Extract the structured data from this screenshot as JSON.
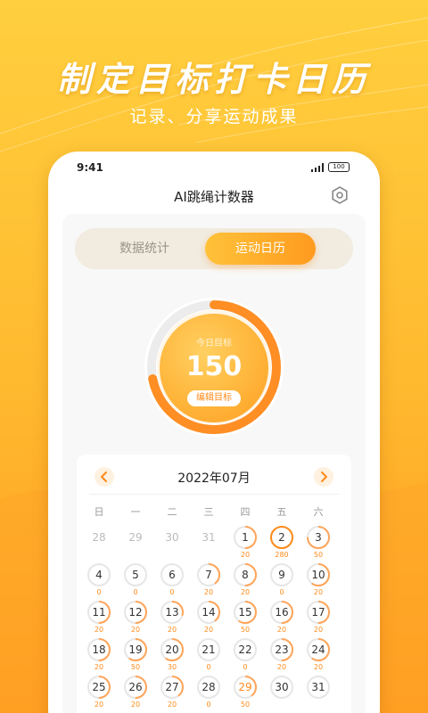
{
  "promo": {
    "title": "制定目标打卡日历",
    "subtitle": "记录、分享运动成果"
  },
  "status_bar": {
    "time": "9:41",
    "battery": "100"
  },
  "nav": {
    "title": "AI跳绳计数器"
  },
  "tabs": [
    {
      "label": "数据统计",
      "active": false
    },
    {
      "label": "运动日历",
      "active": true
    }
  ],
  "goal": {
    "label": "今日目标",
    "value": "150",
    "edit_label": "编辑目标",
    "progress": 0.72
  },
  "calendar": {
    "month": "2022年07月",
    "weekdays": [
      "日",
      "一",
      "二",
      "三",
      "四",
      "五",
      "六"
    ],
    "weeks": [
      [
        {
          "day": "28",
          "count": "",
          "muted": true,
          "progress": 0
        },
        {
          "day": "29",
          "count": "",
          "muted": true,
          "progress": 0
        },
        {
          "day": "30",
          "count": "",
          "muted": true,
          "progress": 0
        },
        {
          "day": "31",
          "count": "",
          "muted": true,
          "progress": 0
        },
        {
          "day": "1",
          "count": "20",
          "progress": 0.5
        },
        {
          "day": "2",
          "count": "280",
          "progress": 1
        },
        {
          "day": "3",
          "count": "50",
          "progress": 0.75
        }
      ],
      [
        {
          "day": "4",
          "count": "0",
          "progress": 0
        },
        {
          "day": "5",
          "count": "0",
          "progress": 0
        },
        {
          "day": "6",
          "count": "0",
          "progress": 0
        },
        {
          "day": "7",
          "count": "20",
          "progress": 0.4
        },
        {
          "day": "8",
          "count": "20",
          "progress": 0.5
        },
        {
          "day": "9",
          "count": "0",
          "progress": 0
        },
        {
          "day": "10",
          "count": "20",
          "progress": 0.6
        }
      ],
      [
        {
          "day": "11",
          "count": "20",
          "progress": 0.5
        },
        {
          "day": "12",
          "count": "20",
          "progress": 0.5
        },
        {
          "day": "13",
          "count": "20",
          "progress": 0.3
        },
        {
          "day": "14",
          "count": "20",
          "progress": 0.4
        },
        {
          "day": "15",
          "count": "50",
          "progress": 0.6
        },
        {
          "day": "16",
          "count": "20",
          "progress": 0.5
        },
        {
          "day": "17",
          "count": "20",
          "progress": 0.5
        }
      ],
      [
        {
          "day": "18",
          "count": "20",
          "progress": 0.5
        },
        {
          "day": "19",
          "count": "50",
          "progress": 0.6
        },
        {
          "day": "20",
          "count": "30",
          "progress": 0.6
        },
        {
          "day": "21",
          "count": "0",
          "progress": 0
        },
        {
          "day": "22",
          "count": "0",
          "progress": 0
        },
        {
          "day": "23",
          "count": "20",
          "progress": 0.5
        },
        {
          "day": "24",
          "count": "20",
          "progress": 0.6
        }
      ],
      [
        {
          "day": "25",
          "count": "20",
          "progress": 0.5
        },
        {
          "day": "26",
          "count": "20",
          "progress": 0.5
        },
        {
          "day": "27",
          "count": "20",
          "progress": 0.4
        },
        {
          "day": "28",
          "count": "0",
          "progress": 0
        },
        {
          "day": "29",
          "count": "50",
          "progress": 0.4,
          "highlight": true
        },
        {
          "day": "30",
          "count": "",
          "progress": 0
        },
        {
          "day": "31",
          "count": "",
          "progress": 0
        }
      ]
    ]
  },
  "colors": {
    "accent": "#ff8b1a",
    "accent_light": "#ffc23a",
    "ring_track": "#ececec"
  }
}
